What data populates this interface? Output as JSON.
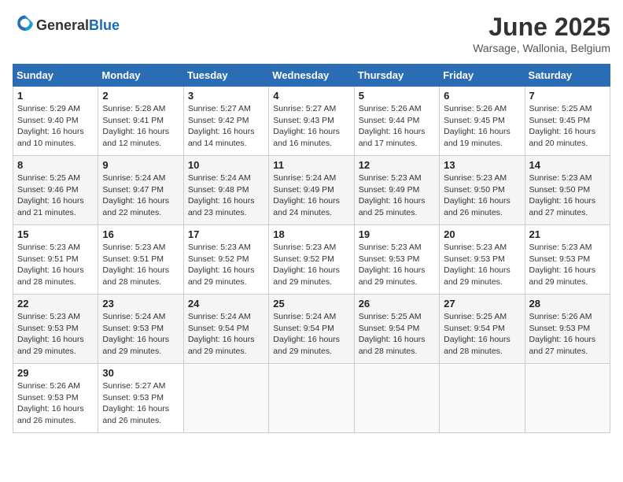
{
  "header": {
    "logo_general": "General",
    "logo_blue": "Blue",
    "month_title": "June 2025",
    "location": "Warsage, Wallonia, Belgium"
  },
  "weekdays": [
    "Sunday",
    "Monday",
    "Tuesday",
    "Wednesday",
    "Thursday",
    "Friday",
    "Saturday"
  ],
  "weeks": [
    [
      {
        "day": "1",
        "sunrise": "Sunrise: 5:29 AM",
        "sunset": "Sunset: 9:40 PM",
        "daylight": "Daylight: 16 hours and 10 minutes."
      },
      {
        "day": "2",
        "sunrise": "Sunrise: 5:28 AM",
        "sunset": "Sunset: 9:41 PM",
        "daylight": "Daylight: 16 hours and 12 minutes."
      },
      {
        "day": "3",
        "sunrise": "Sunrise: 5:27 AM",
        "sunset": "Sunset: 9:42 PM",
        "daylight": "Daylight: 16 hours and 14 minutes."
      },
      {
        "day": "4",
        "sunrise": "Sunrise: 5:27 AM",
        "sunset": "Sunset: 9:43 PM",
        "daylight": "Daylight: 16 hours and 16 minutes."
      },
      {
        "day": "5",
        "sunrise": "Sunrise: 5:26 AM",
        "sunset": "Sunset: 9:44 PM",
        "daylight": "Daylight: 16 hours and 17 minutes."
      },
      {
        "day": "6",
        "sunrise": "Sunrise: 5:26 AM",
        "sunset": "Sunset: 9:45 PM",
        "daylight": "Daylight: 16 hours and 19 minutes."
      },
      {
        "day": "7",
        "sunrise": "Sunrise: 5:25 AM",
        "sunset": "Sunset: 9:45 PM",
        "daylight": "Daylight: 16 hours and 20 minutes."
      }
    ],
    [
      {
        "day": "8",
        "sunrise": "Sunrise: 5:25 AM",
        "sunset": "Sunset: 9:46 PM",
        "daylight": "Daylight: 16 hours and 21 minutes."
      },
      {
        "day": "9",
        "sunrise": "Sunrise: 5:24 AM",
        "sunset": "Sunset: 9:47 PM",
        "daylight": "Daylight: 16 hours and 22 minutes."
      },
      {
        "day": "10",
        "sunrise": "Sunrise: 5:24 AM",
        "sunset": "Sunset: 9:48 PM",
        "daylight": "Daylight: 16 hours and 23 minutes."
      },
      {
        "day": "11",
        "sunrise": "Sunrise: 5:24 AM",
        "sunset": "Sunset: 9:49 PM",
        "daylight": "Daylight: 16 hours and 24 minutes."
      },
      {
        "day": "12",
        "sunrise": "Sunrise: 5:23 AM",
        "sunset": "Sunset: 9:49 PM",
        "daylight": "Daylight: 16 hours and 25 minutes."
      },
      {
        "day": "13",
        "sunrise": "Sunrise: 5:23 AM",
        "sunset": "Sunset: 9:50 PM",
        "daylight": "Daylight: 16 hours and 26 minutes."
      },
      {
        "day": "14",
        "sunrise": "Sunrise: 5:23 AM",
        "sunset": "Sunset: 9:50 PM",
        "daylight": "Daylight: 16 hours and 27 minutes."
      }
    ],
    [
      {
        "day": "15",
        "sunrise": "Sunrise: 5:23 AM",
        "sunset": "Sunset: 9:51 PM",
        "daylight": "Daylight: 16 hours and 28 minutes."
      },
      {
        "day": "16",
        "sunrise": "Sunrise: 5:23 AM",
        "sunset": "Sunset: 9:51 PM",
        "daylight": "Daylight: 16 hours and 28 minutes."
      },
      {
        "day": "17",
        "sunrise": "Sunrise: 5:23 AM",
        "sunset": "Sunset: 9:52 PM",
        "daylight": "Daylight: 16 hours and 29 minutes."
      },
      {
        "day": "18",
        "sunrise": "Sunrise: 5:23 AM",
        "sunset": "Sunset: 9:52 PM",
        "daylight": "Daylight: 16 hours and 29 minutes."
      },
      {
        "day": "19",
        "sunrise": "Sunrise: 5:23 AM",
        "sunset": "Sunset: 9:53 PM",
        "daylight": "Daylight: 16 hours and 29 minutes."
      },
      {
        "day": "20",
        "sunrise": "Sunrise: 5:23 AM",
        "sunset": "Sunset: 9:53 PM",
        "daylight": "Daylight: 16 hours and 29 minutes."
      },
      {
        "day": "21",
        "sunrise": "Sunrise: 5:23 AM",
        "sunset": "Sunset: 9:53 PM",
        "daylight": "Daylight: 16 hours and 29 minutes."
      }
    ],
    [
      {
        "day": "22",
        "sunrise": "Sunrise: 5:23 AM",
        "sunset": "Sunset: 9:53 PM",
        "daylight": "Daylight: 16 hours and 29 minutes."
      },
      {
        "day": "23",
        "sunrise": "Sunrise: 5:24 AM",
        "sunset": "Sunset: 9:53 PM",
        "daylight": "Daylight: 16 hours and 29 minutes."
      },
      {
        "day": "24",
        "sunrise": "Sunrise: 5:24 AM",
        "sunset": "Sunset: 9:54 PM",
        "daylight": "Daylight: 16 hours and 29 minutes."
      },
      {
        "day": "25",
        "sunrise": "Sunrise: 5:24 AM",
        "sunset": "Sunset: 9:54 PM",
        "daylight": "Daylight: 16 hours and 29 minutes."
      },
      {
        "day": "26",
        "sunrise": "Sunrise: 5:25 AM",
        "sunset": "Sunset: 9:54 PM",
        "daylight": "Daylight: 16 hours and 28 minutes."
      },
      {
        "day": "27",
        "sunrise": "Sunrise: 5:25 AM",
        "sunset": "Sunset: 9:54 PM",
        "daylight": "Daylight: 16 hours and 28 minutes."
      },
      {
        "day": "28",
        "sunrise": "Sunrise: 5:26 AM",
        "sunset": "Sunset: 9:53 PM",
        "daylight": "Daylight: 16 hours and 27 minutes."
      }
    ],
    [
      {
        "day": "29",
        "sunrise": "Sunrise: 5:26 AM",
        "sunset": "Sunset: 9:53 PM",
        "daylight": "Daylight: 16 hours and 26 minutes."
      },
      {
        "day": "30",
        "sunrise": "Sunrise: 5:27 AM",
        "sunset": "Sunset: 9:53 PM",
        "daylight": "Daylight: 16 hours and 26 minutes."
      },
      null,
      null,
      null,
      null,
      null
    ]
  ]
}
